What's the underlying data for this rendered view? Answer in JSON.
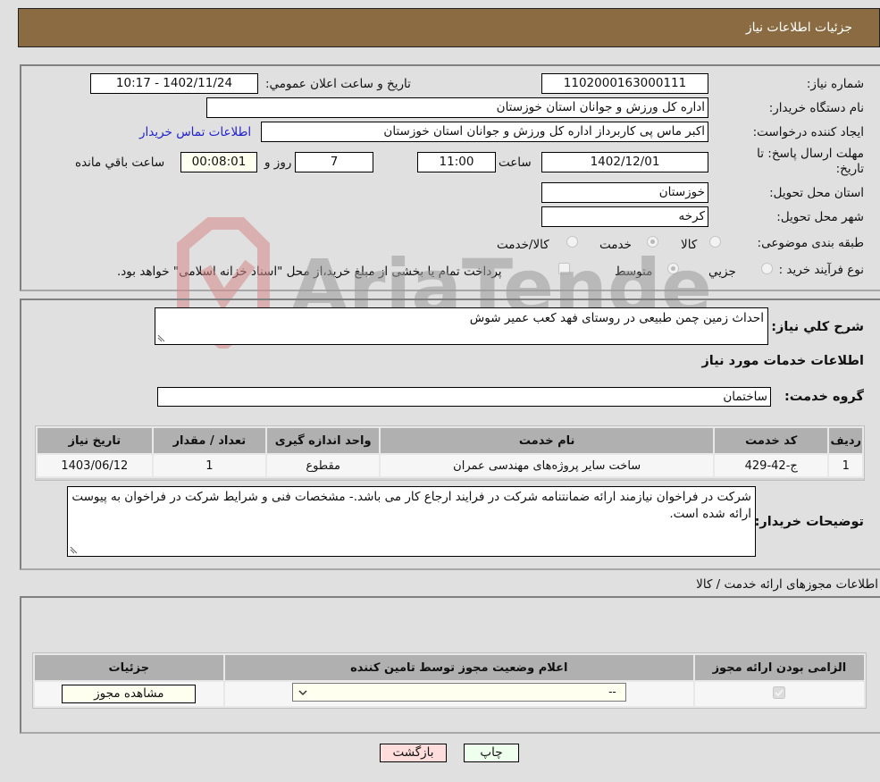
{
  "header": {
    "title": "جزئیات اطلاعات نیاز"
  },
  "form": {
    "need_number": {
      "label": "شماره نیاز:",
      "value": "1102000163000111"
    },
    "announce_datetime": {
      "label": "تاریخ و ساعت اعلان عمومي:",
      "value": "1402/11/24 - 10:17"
    },
    "buyer_org": {
      "label": "نام دستگاه خریدار:",
      "value": "اداره کل ورزش و جوانان استان خوزستان"
    },
    "requester": {
      "label": "ایجاد کننده درخواست:",
      "value": "اکبر ماس پی کاربرداز اداره کل ورزش و جوانان استان خوزستان"
    },
    "buyer_contact_link": "اطلاعات تماس خریدار",
    "deadline": {
      "label_line1": "مهلت ارسال پاسخ: تا",
      "label_line2": "تاریخ:",
      "date": "1402/12/01",
      "time_label": "ساعت",
      "time": "11:00",
      "days": "7",
      "days_label": "روز و",
      "remaining": "00:08:01",
      "remaining_label": "ساعت باقي مانده"
    },
    "province": {
      "label": "استان محل تحویل:",
      "value": "خوزستان"
    },
    "city": {
      "label": "شهر محل تحویل:",
      "value": "کرخه"
    },
    "category": {
      "label": "طبقه بندی موضوعی:",
      "options": [
        "کالا",
        "خدمت",
        "کالا/خدمت"
      ],
      "selected": "خدمت"
    },
    "purchase_process": {
      "label": "نوع فرآیند خرید :",
      "options": [
        "جزیي",
        "متوسط"
      ],
      "selected": "متوسط",
      "treasury_note": "پرداخت تمام یا بخشی از مبلغ خرید،از محل \"اسناد خزانه اسلامی\" خواهد بود."
    }
  },
  "description": {
    "label": "شرح کلي نیاز:",
    "value": "احداث زمین چمن طبیعی در روستای فهد کعب عمیر شوش"
  },
  "services": {
    "section_title": "اطلاعات خدمات مورد نیاز",
    "group_label": "گروه خدمت:",
    "group_value": "ساختمان",
    "table": {
      "headers": [
        "ردیف",
        "کد خدمت",
        "نام خدمت",
        "واحد اندازه گیری",
        "تعداد / مقدار",
        "تاریخ نیاز"
      ],
      "rows": [
        [
          "1",
          "ج-42-429",
          "ساخت سایر پروژه‌های مهندسی عمران",
          "مقطوع",
          "1",
          "1403/06/12"
        ]
      ]
    }
  },
  "buyer_notes": {
    "label": "توضیحات خریدار:",
    "value": "شرکت در فراخوان نیازمند ارائه ضمانتنامه شرکت در فرایند ارجاع کار می باشد.- مشخصات فنی و شرایط شرکت در فراخوان به پیوست ارائه شده است."
  },
  "permits": {
    "section_title": "اطلاعات مجوزهای ارائه خدمت / کالا",
    "table": {
      "headers": [
        "الزامی بودن ارائه مجوز",
        "اعلام وضعیت مجوز توسط تامین کننده",
        "جزئیات"
      ],
      "row": {
        "required_checked": true,
        "status_selected": "--",
        "details_button": "مشاهده مجوز"
      }
    }
  },
  "actions": {
    "print": "چاپ",
    "back": "بازگشت"
  },
  "watermark": {
    "text": "AriaTender.neT"
  },
  "colors": {
    "header_bg": "#8b6c42",
    "link": "#2222cc",
    "print_bg": "#eeffee",
    "back_bg": "#ffdddd"
  }
}
